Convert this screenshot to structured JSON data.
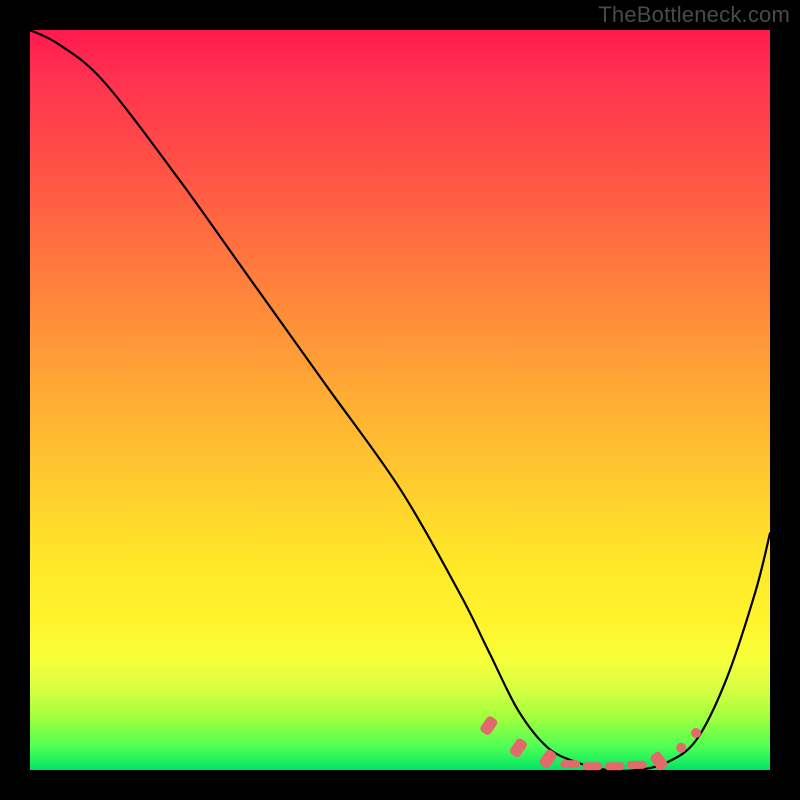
{
  "watermark": "TheBottleneck.com",
  "chart_data": {
    "type": "line",
    "title": "",
    "xlabel": "",
    "ylabel": "",
    "xlim": [
      0,
      100
    ],
    "ylim": [
      0,
      100
    ],
    "grid": false,
    "legend": false,
    "background_gradient": {
      "orientation": "vertical",
      "stops": [
        {
          "pos": 0.0,
          "color": "#ff1a4d"
        },
        {
          "pos": 0.18,
          "color": "#ff5046"
        },
        {
          "pos": 0.46,
          "color": "#ffa236"
        },
        {
          "pos": 0.72,
          "color": "#ffe828"
        },
        {
          "pos": 0.89,
          "color": "#d8ff42"
        },
        {
          "pos": 1.0,
          "color": "#00e463"
        }
      ]
    },
    "series": [
      {
        "name": "bottleneck-curve",
        "x": [
          0,
          4,
          10,
          20,
          30,
          40,
          50,
          58,
          62,
          66,
          70,
          74,
          78,
          82,
          86,
          90,
          94,
          98,
          100
        ],
        "y": [
          100,
          98,
          93,
          80,
          66,
          52,
          38,
          24,
          16,
          8,
          3,
          1,
          0,
          0,
          1,
          4,
          12,
          24,
          32
        ]
      }
    ],
    "markers": [
      {
        "x": 62,
        "y": 6,
        "shape": "pill"
      },
      {
        "x": 66,
        "y": 3,
        "shape": "pill"
      },
      {
        "x": 70,
        "y": 1.5,
        "shape": "pill"
      },
      {
        "x": 73,
        "y": 0.8,
        "shape": "dash"
      },
      {
        "x": 76,
        "y": 0.5,
        "shape": "dash"
      },
      {
        "x": 79,
        "y": 0.5,
        "shape": "dash"
      },
      {
        "x": 82,
        "y": 0.7,
        "shape": "dash"
      },
      {
        "x": 85,
        "y": 1.2,
        "shape": "pill"
      },
      {
        "x": 88,
        "y": 3,
        "shape": "dot"
      },
      {
        "x": 90,
        "y": 5,
        "shape": "dot"
      }
    ],
    "colors": {
      "curve": "#000000",
      "markers": "#e36a6a"
    }
  }
}
